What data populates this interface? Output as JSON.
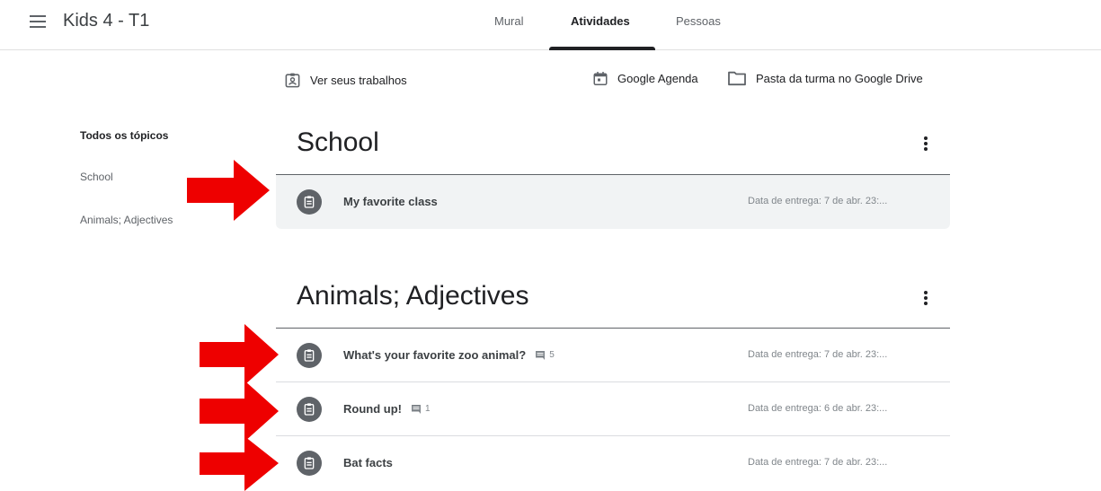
{
  "header": {
    "class_title": "Kids 4 - T1",
    "tabs": [
      {
        "label": "Mural",
        "active": false
      },
      {
        "label": "Atividades",
        "active": true
      },
      {
        "label": "Pessoas",
        "active": false
      }
    ]
  },
  "actions": {
    "view_work": "Ver seus trabalhos",
    "calendar": "Google Agenda",
    "drive_folder": "Pasta da turma no Google Drive"
  },
  "sidebar": {
    "items": [
      {
        "label": "Todos os tópicos",
        "active": true
      },
      {
        "label": "School",
        "active": false
      },
      {
        "label": "Animals; Adjectives",
        "active": false
      }
    ]
  },
  "sections": [
    {
      "title": "School",
      "assignments": [
        {
          "title": "My favorite class",
          "comments": "",
          "due": "Data de entrega: 7 de abr. 23:..."
        }
      ]
    },
    {
      "title": "Animals; Adjectives",
      "assignments": [
        {
          "title": "What's your favorite zoo animal?",
          "comments": "5",
          "due": "Data de entrega: 7 de abr. 23:..."
        },
        {
          "title": "Round up!",
          "comments": "1",
          "due": "Data de entrega: 6 de abr. 23:..."
        },
        {
          "title": "Bat facts",
          "comments": "",
          "due": "Data de entrega: 7 de abr. 23:..."
        }
      ]
    }
  ],
  "colors": {
    "arrow": "#ee0000",
    "icon_bg": "#5f6368",
    "highlight_bg": "#f1f3f4",
    "text_dark": "#202124",
    "text_muted": "#80868b"
  }
}
